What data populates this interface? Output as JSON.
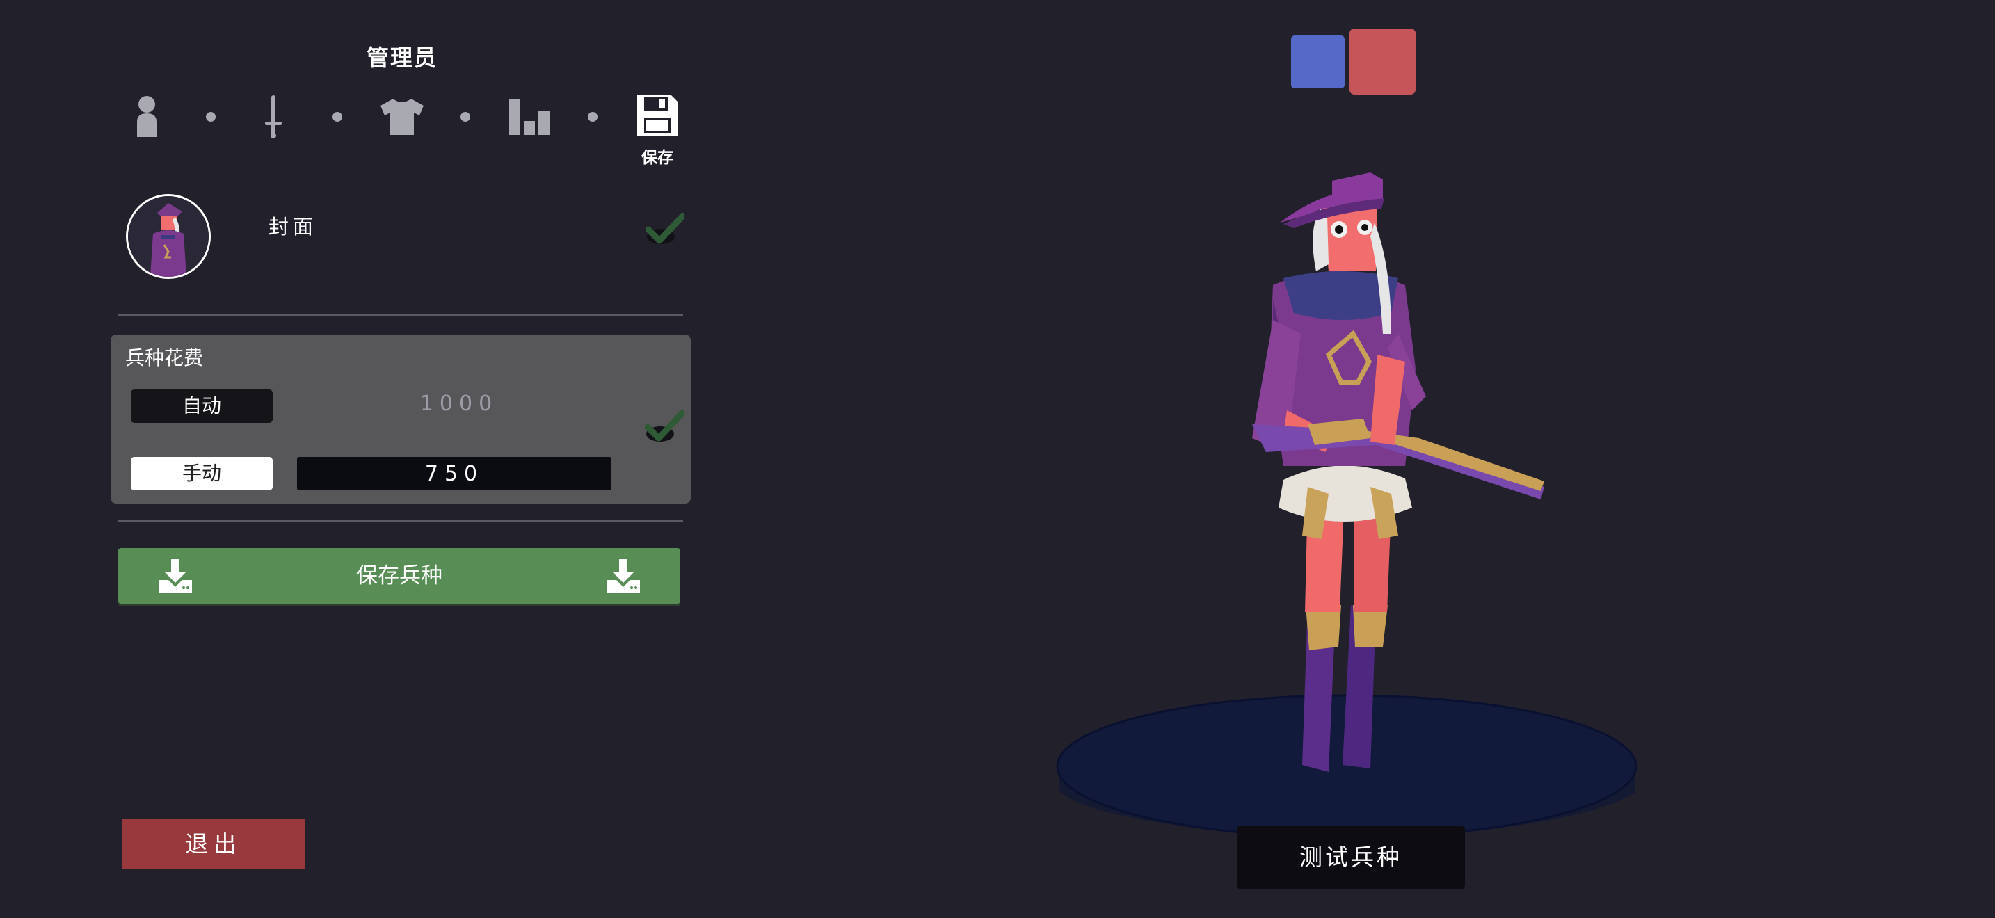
{
  "editor": {
    "title": "管理员",
    "steps": [
      {
        "name": "unit-base",
        "icon": "person-icon"
      },
      {
        "name": "weapons",
        "icon": "sword-icon"
      },
      {
        "name": "clothing",
        "icon": "shirt-icon"
      },
      {
        "name": "stats",
        "icon": "bar-chart-icon"
      },
      {
        "name": "save",
        "icon": "floppy-disk-icon",
        "label": "保存"
      }
    ]
  },
  "cover": {
    "label": "封面",
    "checked": true
  },
  "cost": {
    "title": "兵种花费",
    "auto_label": "自动",
    "auto_value": "1000",
    "manual_label": "手动",
    "manual_value": "750",
    "checked": true
  },
  "save_unit": {
    "label": "保存兵种",
    "icon": "download-icon"
  },
  "exit": {
    "label": "退出"
  },
  "teams": {
    "blue_color": "#5569c8",
    "red_color": "#c6555a",
    "selected": "red"
  },
  "test": {
    "label": "测试兵种"
  },
  "colors": {
    "background": "#21202b",
    "panel": "#575659",
    "save_green": "#588e56",
    "exit_red": "#983a3d"
  }
}
